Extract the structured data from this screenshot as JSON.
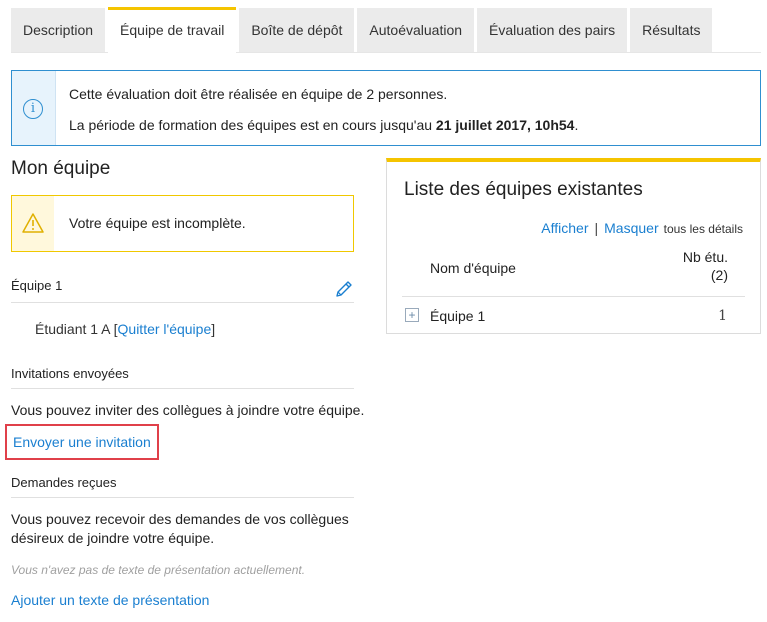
{
  "tabs": [
    {
      "label": "Description",
      "active": false
    },
    {
      "label": "Équipe de travail",
      "active": true
    },
    {
      "label": "Boîte de dépôt",
      "active": false
    },
    {
      "label": "Autoévaluation",
      "active": false
    },
    {
      "label": "Évaluation des pairs",
      "active": false
    },
    {
      "label": "Résultats",
      "active": false
    }
  ],
  "info": {
    "icon": "info-circle-icon",
    "line1_prefix": "Cette évaluation doit être réalisée en équipe de ",
    "line1_count": "2",
    "line1_suffix": " personnes.",
    "line2_prefix": "La période de formation des équipes est en cours jusqu'au ",
    "line2_deadline": "21 juillet 2017, 10h54",
    "line2_suffix": "."
  },
  "my_team": {
    "heading": "Mon équipe",
    "warning_icon": "warning-triangle-icon",
    "warning": "Votre équipe est incomplète.",
    "team_name": "Équipe 1",
    "edit_icon": "pencil-icon",
    "member": "Étudiant 1 A",
    "bracket_open": "[",
    "leave_link": "Quitter l'équipe",
    "bracket_close": "]"
  },
  "invitations": {
    "title": "Invitations envoyées",
    "text": "Vous pouvez inviter des collègues à joindre votre équipe.",
    "send_link": "Envoyer une invitation"
  },
  "requests": {
    "title": "Demandes reçues",
    "text_line1": "Vous pouvez recevoir des demandes de vos collègues",
    "text_line2": "désireux de joindre votre équipe.",
    "no_presentation": "Vous n'avez pas de texte de présentation actuellement.",
    "add_link": "Ajouter un texte de présentation"
  },
  "teams_list": {
    "title": "Liste des équipes existantes",
    "show_link": "Afficher",
    "separator": "|",
    "hide_link": "Masquer",
    "details_text": "tous les détails",
    "col_name": "Nom d'équipe",
    "col_nb_line1": "Nb étu.",
    "col_nb_line2": "(2)",
    "rows": [
      {
        "expand_icon": "plus-square-icon",
        "expand_symbol": "+",
        "name": "Équipe 1",
        "count": "1"
      }
    ]
  },
  "colors": {
    "accent_yellow": "#f5c400",
    "link_blue": "#1a7fd0",
    "info_border": "#2f8fd0",
    "highlight_red": "#e0404a"
  }
}
